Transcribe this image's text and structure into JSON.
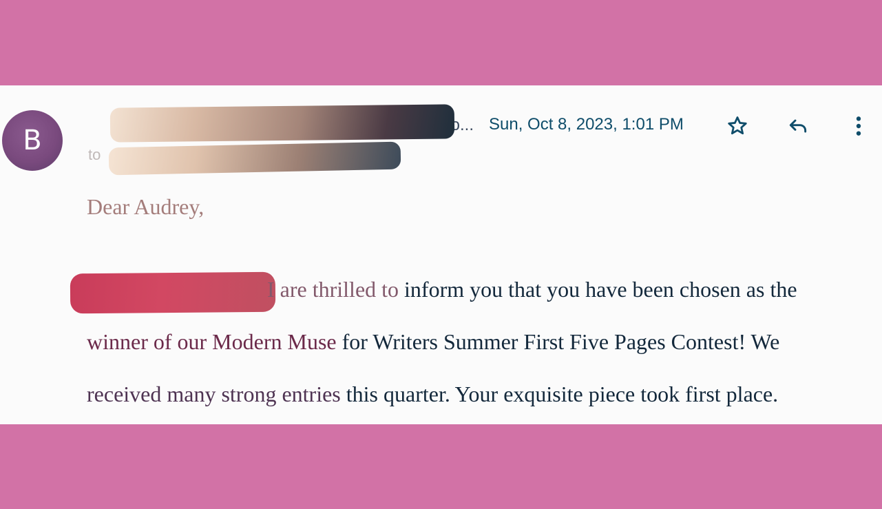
{
  "email": {
    "avatar_letter": "B",
    "sender_tail": "fo...",
    "timestamp": "Sun, Oct 8, 2023, 1:01 PM",
    "recipient_prefix": "to"
  },
  "actions": {
    "star_icon": "star-icon",
    "reply_icon": "reply-icon",
    "more_icon": "more-vertical-icon"
  },
  "body": {
    "greeting": "Dear Audrey,",
    "line1_soft": "I are thrilled to ",
    "line1_rest": "inform you that you have been chosen as the",
    "line2_soft": "winner of our Modern Muse ",
    "line2_rest": "for Writers Summer First Five Pages Contest! We",
    "line3_soft": "received many strong entries ",
    "line3_rest": "this quarter. Your exquisite piece took first place."
  },
  "colors": {
    "frame_pink": "#d272a6",
    "timestamp_blue": "#0f4d6a",
    "body_text": "#13283b",
    "greeting_text": "#a47d7b"
  }
}
